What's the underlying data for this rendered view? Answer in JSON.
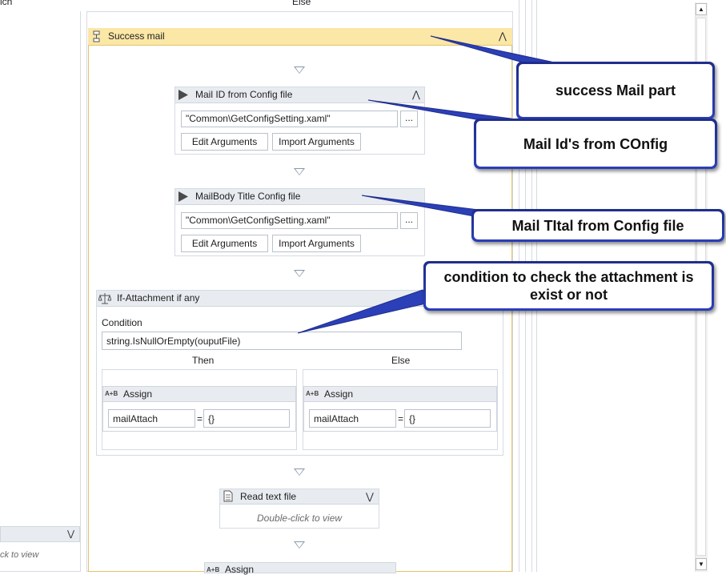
{
  "top": {
    "left_label": "ich",
    "else_label": "Else"
  },
  "success": {
    "title": "Success mail",
    "collapse_icon": "double-chevron-up-icon"
  },
  "mail_id": {
    "title": "Mail ID from Config file",
    "path": "\"Common\\GetConfigSetting.xaml\"",
    "browse": "...",
    "edit": "Edit Arguments",
    "import": "Import Arguments"
  },
  "mail_body": {
    "title": "MailBody Title Config file",
    "path": "\"Common\\GetConfigSetting.xaml\"",
    "browse": "...",
    "edit": "Edit Arguments",
    "import": "Import Arguments"
  },
  "if_block": {
    "title": "If-Attachment if any",
    "condition_label": "Condition",
    "condition": "string.IsNullOrEmpty(ouputFile)",
    "then_label": "Then",
    "else_label": "Else"
  },
  "assign_then": {
    "title": "Assign",
    "icon_text": "A+B",
    "to": "mailAttach",
    "eq": "=",
    "value": "{}"
  },
  "assign_else": {
    "title": "Assign",
    "icon_text": "A+B",
    "to": "mailAttach",
    "eq": "=",
    "value": "{}"
  },
  "read_text": {
    "title": "Read text file",
    "hint": "Double-click to view"
  },
  "assign_bottom": {
    "title": "Assign",
    "icon_text": "A+B"
  },
  "left_bottom": {
    "hint": "ck to view"
  },
  "callouts": {
    "success": "success Mail part",
    "mail_id": "Mail Id's from COnfig",
    "mail_title": "Mail TItal from Config file",
    "condition": "condition to check the attachment is exist or not"
  },
  "colors": {
    "success_header": "#fbe7a6",
    "callout_border": "#2436a8",
    "panel_border": "#d5dbe3"
  }
}
